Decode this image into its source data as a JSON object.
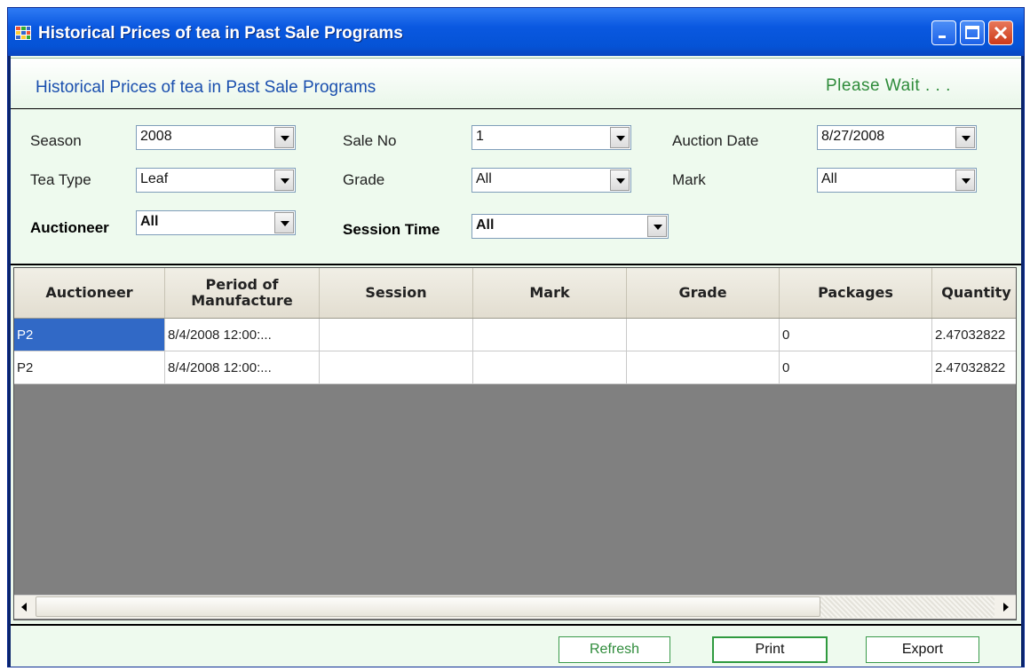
{
  "window": {
    "title": "Historical Prices of tea in Past Sale Programs"
  },
  "header": {
    "title": "Historical Prices of tea in Past Sale Programs",
    "status": "Please Wait . . ."
  },
  "filters": {
    "season": {
      "label": "Season",
      "value": "2008"
    },
    "sale_no": {
      "label": "Sale No",
      "value": "1"
    },
    "auction_date": {
      "label": "Auction Date",
      "value": "8/27/2008"
    },
    "tea_type": {
      "label": "Tea Type",
      "value": "Leaf"
    },
    "grade": {
      "label": "Grade",
      "value": "All"
    },
    "mark": {
      "label": "Mark",
      "value": "All"
    },
    "auctioneer": {
      "label": "Auctioneer",
      "value": "All"
    },
    "session_time": {
      "label": "Session Time",
      "value": "All"
    }
  },
  "grid": {
    "columns": [
      "Auctioneer",
      "Period of Manufacture",
      "Session",
      "Mark",
      "Grade",
      "Packages",
      "Quantity"
    ],
    "rows": [
      [
        "P2",
        "8/4/2008 12:00:...",
        "",
        "",
        "",
        "0",
        "2.47032822"
      ],
      [
        "P2",
        "8/4/2008 12:00:...",
        "",
        "",
        "",
        "0",
        "2.47032822"
      ]
    ]
  },
  "footer": {
    "refresh_label": "Refresh",
    "print_label": "Print",
    "export_label": "Export"
  },
  "colors": {
    "title_bar": "#0553d6",
    "header_title": "#1a4fae",
    "status_text": "#2e8b3a",
    "panel_bg": "#eefaee",
    "grid_bg": "#808080",
    "selection": "#3169c6"
  }
}
